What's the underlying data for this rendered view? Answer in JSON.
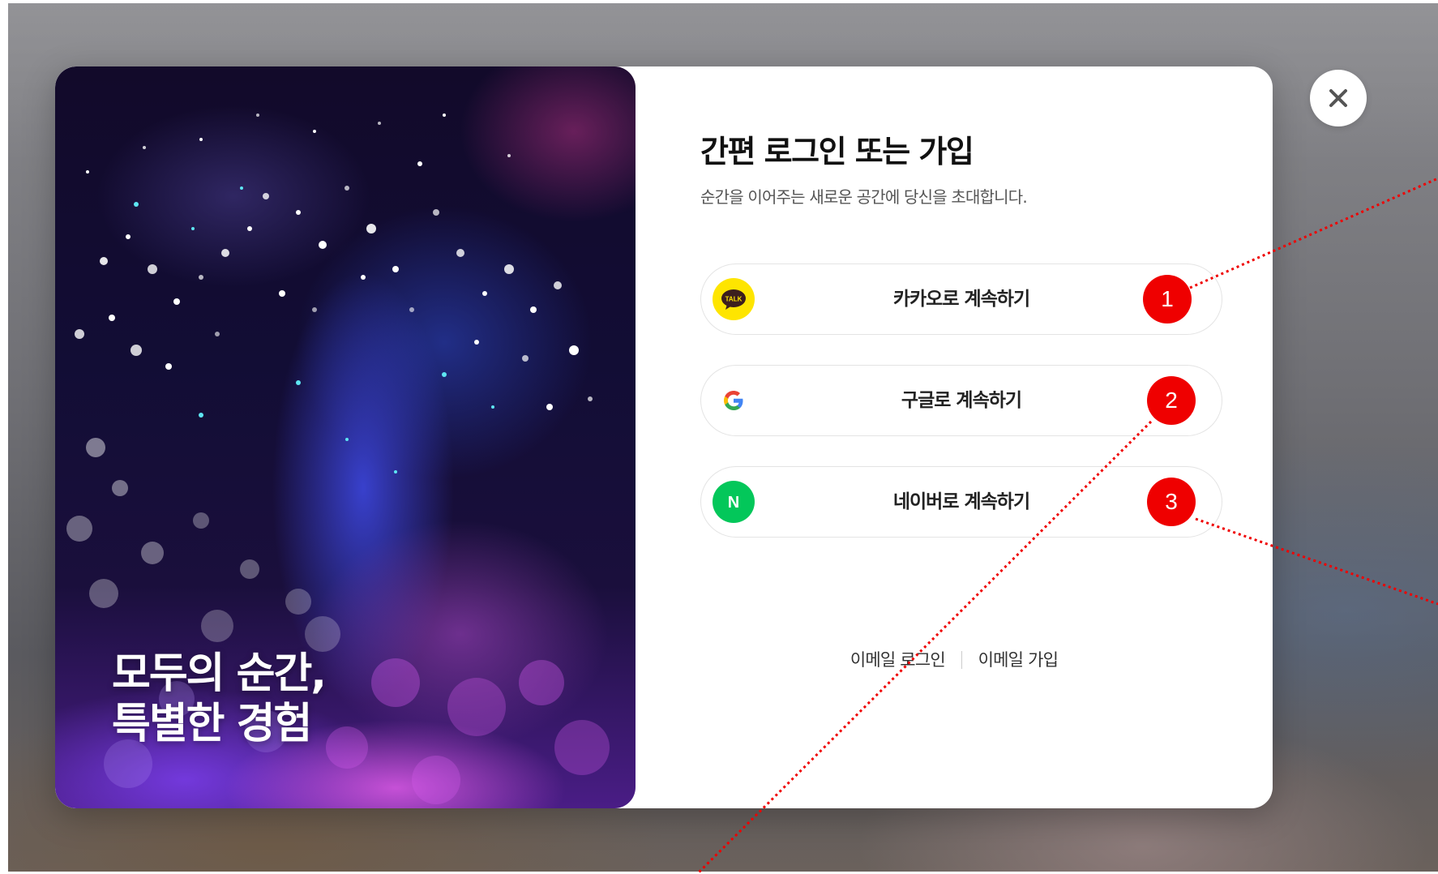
{
  "hero": {
    "line1": "모두의 순간,",
    "line2": "특별한 경험"
  },
  "login": {
    "title": "간편 로그인 또는 가입",
    "subtitle": "순간을 이어주는 새로운 공간에 당신을 초대합니다.",
    "buttons": [
      {
        "label": "카카오로 계속하기",
        "icon": "kakao-talk-icon",
        "color": "#fee500"
      },
      {
        "label": "구글로 계속하기",
        "icon": "google-g-icon",
        "color": "#4285f4"
      },
      {
        "label": "네이버로 계속하기",
        "icon": "naver-n-icon",
        "color": "#03c75a"
      }
    ],
    "email_login": "이메일 로그인",
    "email_signup": "이메일 가입",
    "kakao_logo_text": "TALK",
    "naver_logo_text": "N"
  },
  "close": {
    "icon": "close-icon"
  },
  "annotations": {
    "markers": [
      "1",
      "2",
      "3"
    ],
    "color": "#ef0000"
  }
}
